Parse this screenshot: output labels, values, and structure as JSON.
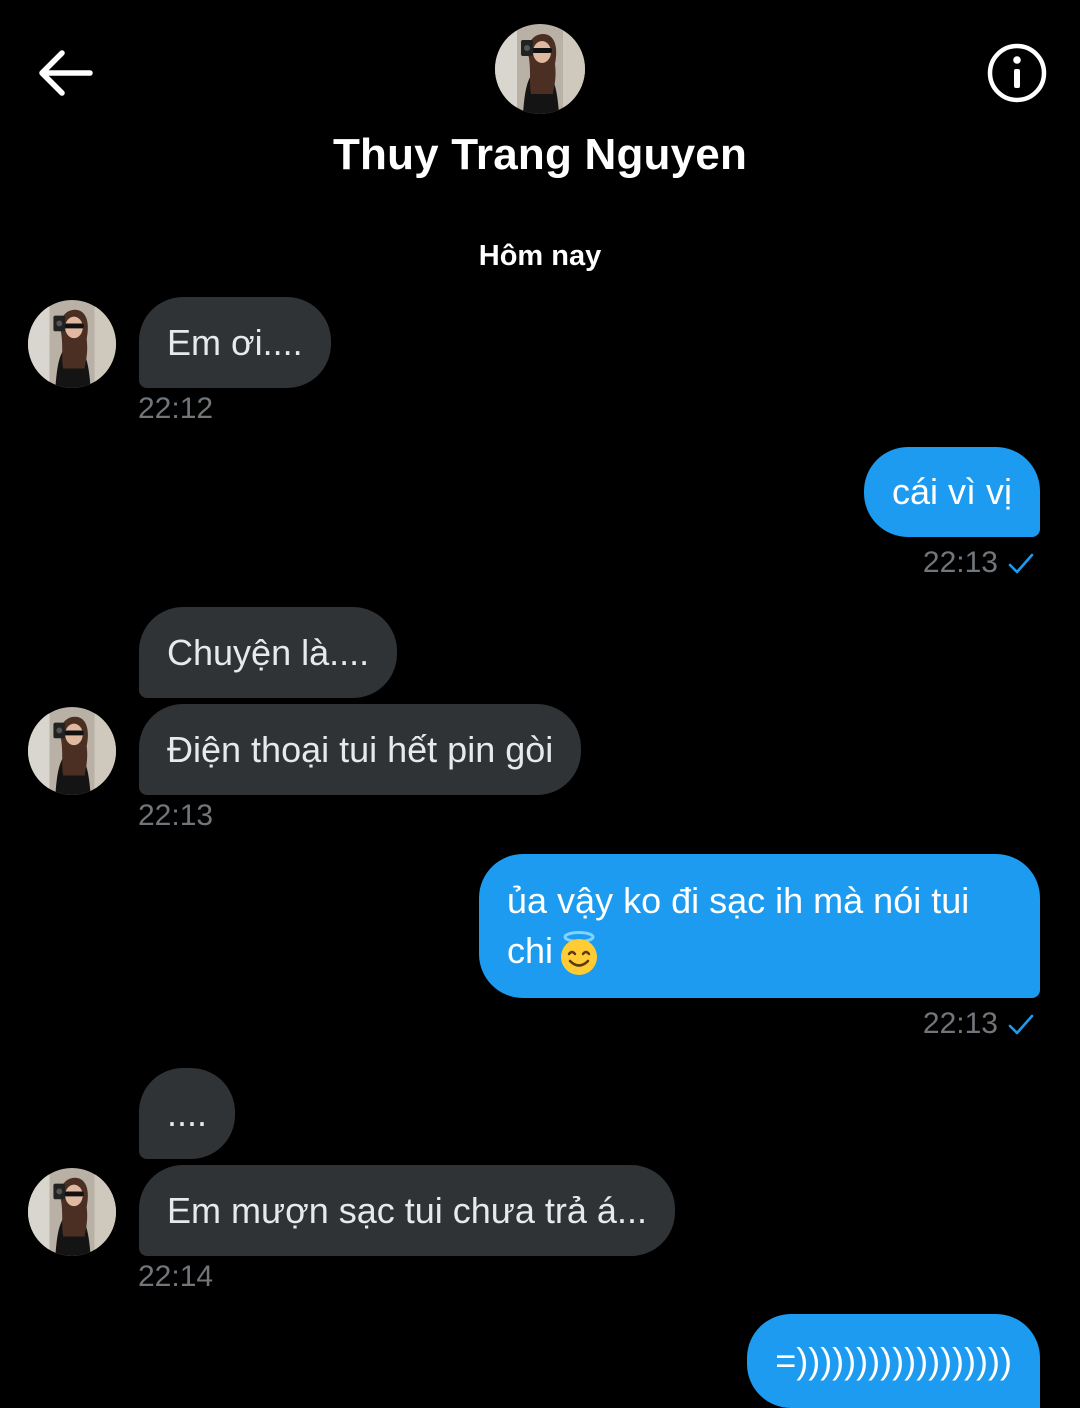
{
  "header": {
    "contact_name": "Thuy Trang Nguyen",
    "date_label": "Hôm nay"
  },
  "messages": [
    {
      "text": "Em ơi....",
      "time": "22:12"
    },
    {
      "text": "cái vì vị",
      "time": "22:13"
    },
    {
      "text": "Chuyện là...."
    },
    {
      "text": "Điện thoại tui hết pin gòi",
      "time": "22:13"
    },
    {
      "text": "ủa vậy ko đi sạc ih mà nói tui chi",
      "emoji": "smiling-face-with-halo",
      "time": "22:13"
    },
    {
      "text": "...."
    },
    {
      "text": "Em mượn sạc tui chưa trả á...",
      "time": "22:14"
    },
    {
      "text": "=))))))))))))))))))"
    }
  ],
  "colors": {
    "background": "#000000",
    "incoming_bubble": "#2f3336",
    "outgoing_bubble": "#1d9bf0",
    "timestamp": "#71767b",
    "read_check": "#1d9bf0"
  },
  "icons": {
    "back": "arrow-left-icon",
    "info": "info-circle-icon",
    "read_receipt": "checkmark-icon"
  }
}
